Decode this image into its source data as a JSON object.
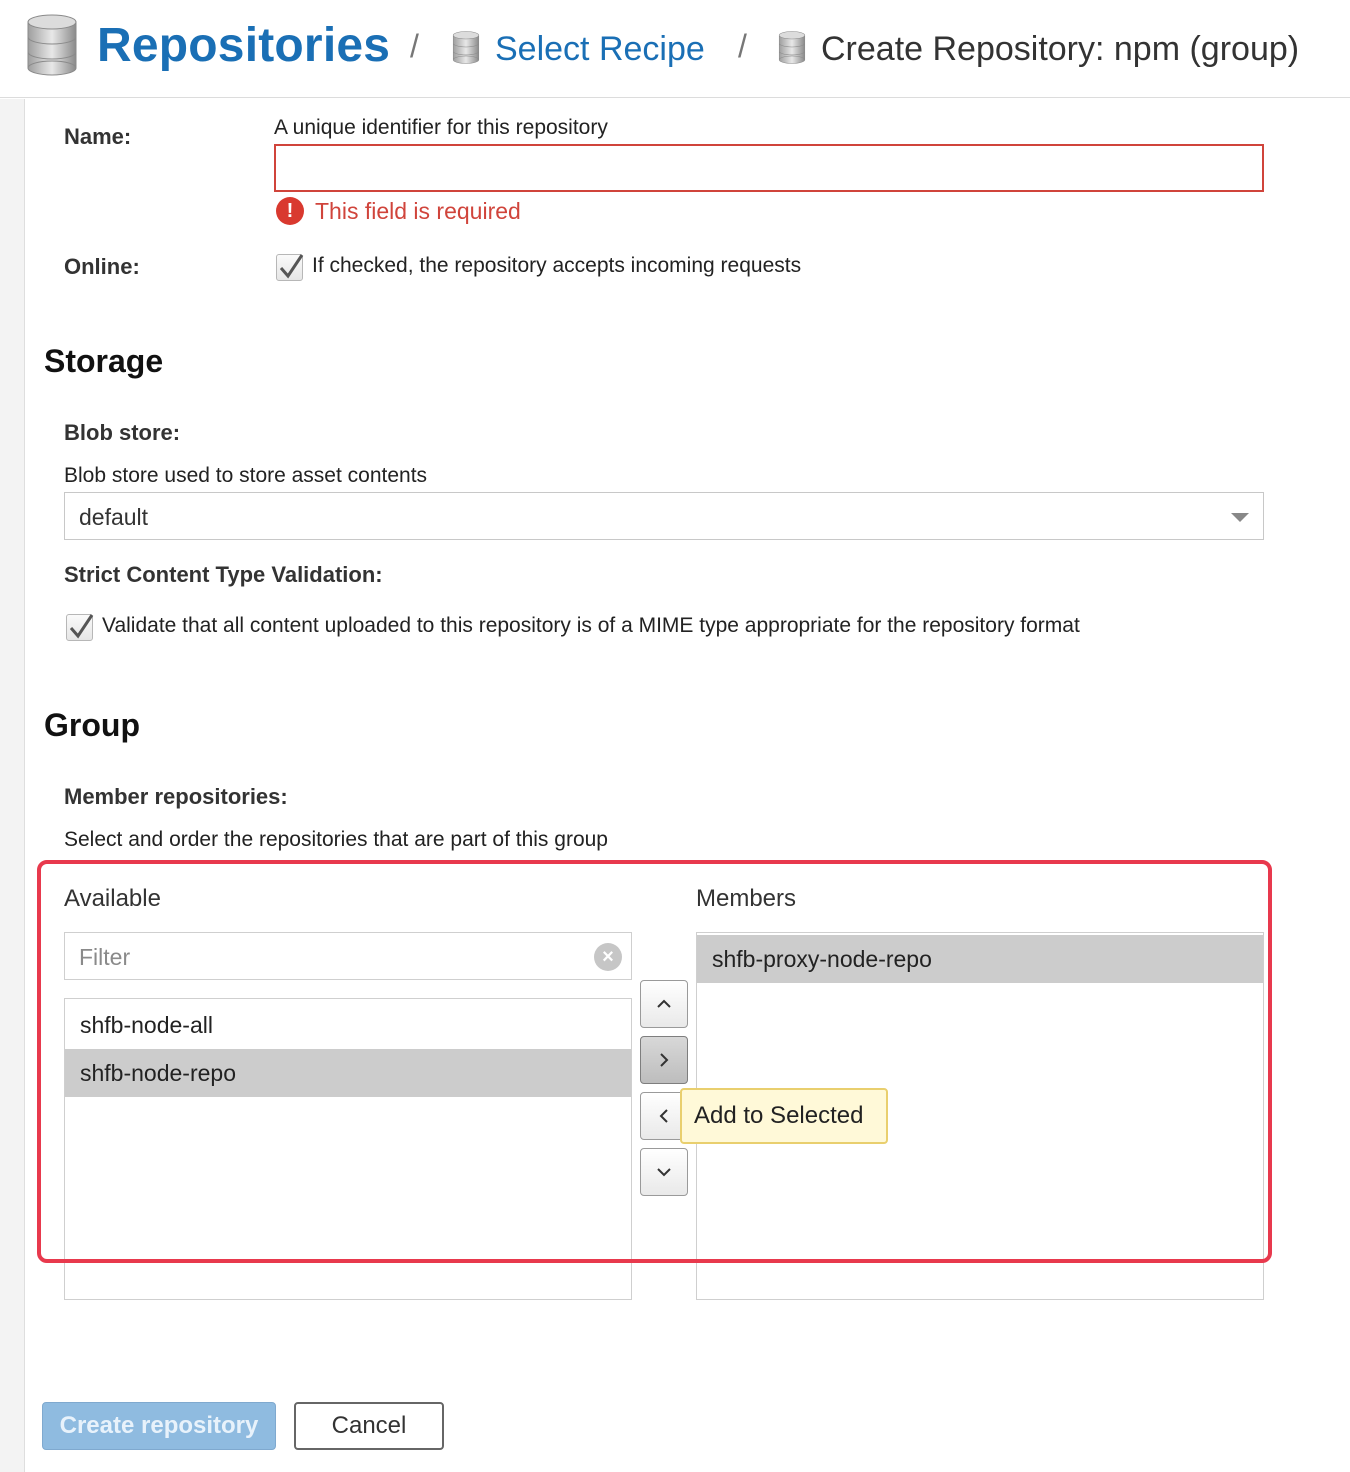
{
  "breadcrumb": {
    "root": "Repositories",
    "separator": "/",
    "recipe": "Select Recipe",
    "current": "Create Repository: npm (group)",
    "icon": "database-icon"
  },
  "form": {
    "name": {
      "label": "Name:",
      "help": "A unique identifier for this repository",
      "value": "",
      "error": "This field is required"
    },
    "online": {
      "label": "Online:",
      "checked": true,
      "help": "If checked, the repository accepts incoming requests"
    }
  },
  "storage": {
    "title": "Storage",
    "blob_label": "Blob store:",
    "blob_help": "Blob store used to store asset contents",
    "blob_value": "default",
    "strict_label": "Strict Content Type Validation:",
    "strict_checked": true,
    "strict_help": "Validate that all content uploaded to this repository is of a MIME type appropriate for the repository format"
  },
  "group": {
    "title": "Group",
    "members_label": "Member repositories:",
    "members_help": "Select and order the repositories that are part of this group",
    "available_title": "Available",
    "filter_placeholder": "Filter",
    "available": [
      {
        "label": "shfb-node-all",
        "selected": false
      },
      {
        "label": "shfb-node-repo",
        "selected": true
      }
    ],
    "members_title": "Members",
    "members": [
      {
        "label": "shfb-proxy-node-repo",
        "selected": true
      }
    ],
    "tooltip": "Add to Selected"
  },
  "actions": {
    "create": "Create repository",
    "cancel": "Cancel"
  },
  "colors": {
    "accent": "#1a6fb5",
    "error": "#d0443b",
    "highlight": "#e8394d"
  }
}
